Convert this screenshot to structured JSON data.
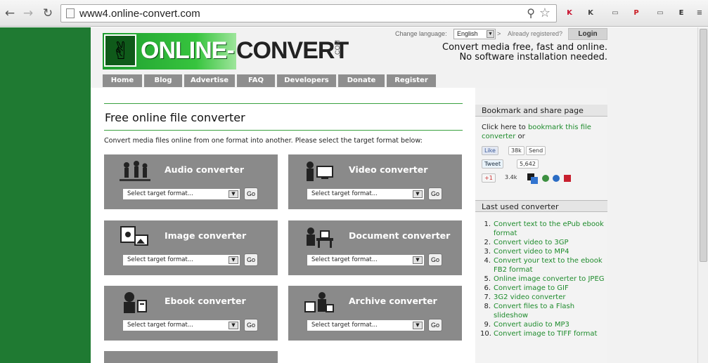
{
  "browser": {
    "url": "www4.online-convert.com",
    "back_glyph": "←",
    "forward_glyph": "→",
    "reload_glyph": "↻",
    "icons": [
      "back-icon",
      "forward-icon",
      "reload-icon",
      "page-icon",
      "zoom-icon",
      "star-icon"
    ],
    "extensions": [
      {
        "name": "kaspersky-extension-icon",
        "glyph": "K",
        "color": "#c8102e"
      },
      {
        "name": "k-extension-icon",
        "glyph": "K",
        "color": "#444"
      },
      {
        "name": "tab-extension-icon",
        "glyph": "▭",
        "color": "#555"
      },
      {
        "name": "pinterest-extension-icon",
        "glyph": "P",
        "color": "#cb2027"
      },
      {
        "name": "window-extension-icon",
        "glyph": "▭",
        "color": "#555"
      },
      {
        "name": "evernote-extension-icon",
        "glyph": "E",
        "color": "#2f2f2f"
      },
      {
        "name": "menu-icon",
        "glyph": "≡",
        "color": "#555"
      }
    ]
  },
  "header": {
    "logo_primary": "ONLINE-",
    "logo_secondary": "CONVERT",
    "logo_suffix": ".COM",
    "change_language_label": "Change language:",
    "language_value": "English",
    "language_go": ">",
    "registered_label": "Already registered?",
    "login_label": "Login",
    "tagline_line1": "Convert media free, fast and online.",
    "tagline_line2": "No software installation needed."
  },
  "nav": [
    {
      "label": "Home",
      "w": 56
    },
    {
      "label": "Blog",
      "w": 54
    },
    {
      "label": "Advertise",
      "w": 72
    },
    {
      "label": "FAQ",
      "w": 54
    },
    {
      "label": "Developers",
      "w": 84
    },
    {
      "label": "Donate",
      "w": 66
    },
    {
      "label": "Register",
      "w": 70
    }
  ],
  "main": {
    "title": "Free online file converter",
    "intro": "Convert media files online from one format into another. Please select the target format below:",
    "select_placeholder": "Select target format...",
    "go_label": "Go",
    "converters": [
      {
        "name": "Audio converter",
        "icon": "audio-converter-icon"
      },
      {
        "name": "Video converter",
        "icon": "video-converter-icon"
      },
      {
        "name": "Image converter",
        "icon": "image-converter-icon"
      },
      {
        "name": "Document converter",
        "icon": "document-converter-icon"
      },
      {
        "name": "Ebook converter",
        "icon": "ebook-converter-icon"
      },
      {
        "name": "Archive converter",
        "icon": "archive-converter-icon"
      }
    ]
  },
  "sidebar": {
    "bookmark_heading": "Bookmark and share page",
    "bookmark_prefix": "Click here to ",
    "bookmark_link": "bookmark this file converter",
    "bookmark_suffix": " or",
    "like_label": "Like",
    "like_count": "38k",
    "send_label": "Send",
    "tweet_label": "Tweet",
    "tweet_count": "5,642",
    "plusone_label": "+1",
    "plusone_count": "3.4k",
    "last_used_heading": "Last used converter",
    "last_used": [
      "Convert text to the ePub ebook format",
      "Convert video to 3GP",
      "Convert video to MP4",
      "Convert your text to the ebook FB2 format",
      "Online image converter to JPEG",
      "Convert image to GIF",
      "3G2 video converter",
      "Convert files to a Flash slideshow",
      "Convert audio to MP3",
      "Convert image to TIFF format"
    ]
  },
  "colors": {
    "green_side": "#1f7a32",
    "link_green": "#1e8b2c",
    "tile_gray": "#8a8a8a",
    "nav_gray": "#8e8e8e"
  }
}
